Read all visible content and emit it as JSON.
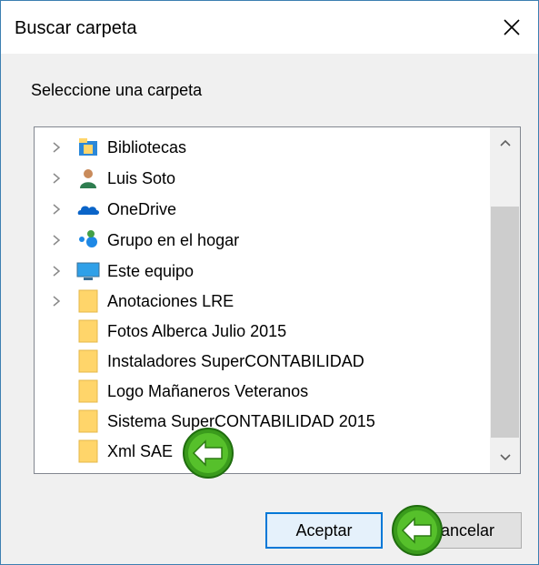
{
  "dialog": {
    "title": "Buscar carpeta",
    "prompt": "Seleccione una carpeta"
  },
  "tree": {
    "items": [
      {
        "label": "Bibliotecas",
        "icon": "libraries-icon",
        "expandable": true
      },
      {
        "label": "Luis Soto",
        "icon": "user-icon",
        "expandable": true
      },
      {
        "label": "OneDrive",
        "icon": "onedrive-icon",
        "expandable": true
      },
      {
        "label": "Grupo en el hogar",
        "icon": "homegroup-icon",
        "expandable": true
      },
      {
        "label": "Este equipo",
        "icon": "computer-icon",
        "expandable": true
      },
      {
        "label": "Anotaciones LRE",
        "icon": "folder-icon",
        "expandable": true
      },
      {
        "label": "Fotos Alberca Julio 2015",
        "icon": "folder-icon",
        "expandable": false
      },
      {
        "label": "Instaladores SuperCONTABILIDAD",
        "icon": "folder-icon",
        "expandable": false
      },
      {
        "label": "Logo Mañaneros Veteranos",
        "icon": "folder-icon",
        "expandable": false
      },
      {
        "label": "Sistema SuperCONTABILIDAD 2015",
        "icon": "folder-icon",
        "expandable": false
      },
      {
        "label": "Xml SAE",
        "icon": "folder-icon",
        "expandable": false
      }
    ]
  },
  "buttons": {
    "ok_label": "Aceptar",
    "cancel_label": "Cancelar"
  },
  "colors": {
    "accent": "#0078d7",
    "folder": "#ffd56a",
    "overlay_green": "#3a9b1c"
  }
}
